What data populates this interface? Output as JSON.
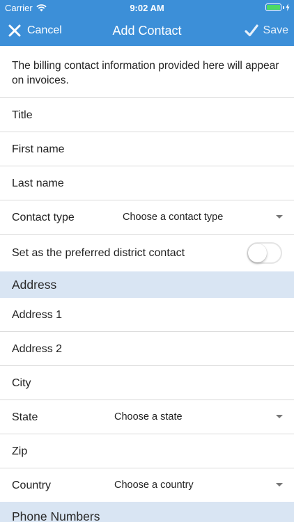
{
  "status_bar": {
    "carrier": "Carrier",
    "time": "9:02 AM",
    "battery_level": 1.0
  },
  "nav": {
    "cancel_label": "Cancel",
    "title": "Add Contact",
    "save_label": "Save"
  },
  "info_text": "The billing contact information provided here will appear on invoices.",
  "fields": {
    "title": "Title",
    "first_name": "First name",
    "last_name": "Last name",
    "contact_type": {
      "label": "Contact type",
      "placeholder": "Choose a contact type"
    },
    "preferred": {
      "label": "Set as the preferred district contact",
      "on": false
    }
  },
  "address_section": {
    "header": "Address",
    "address1": "Address 1",
    "address2": "Address 2",
    "city": "City",
    "state": {
      "label": "State",
      "placeholder": "Choose a state"
    },
    "zip": "Zip",
    "country": {
      "label": "Country",
      "placeholder": "Choose a country"
    }
  },
  "phone_section": {
    "header": "Phone Numbers"
  },
  "colors": {
    "primary": "#3c8fd8",
    "section_bg": "#d9e5f3",
    "battery": "#4cd964"
  },
  "icons": {
    "cancel": "close-icon",
    "save": "checkmark-icon",
    "wifi": "wifi-icon",
    "dropdown": "caret-down-icon"
  }
}
